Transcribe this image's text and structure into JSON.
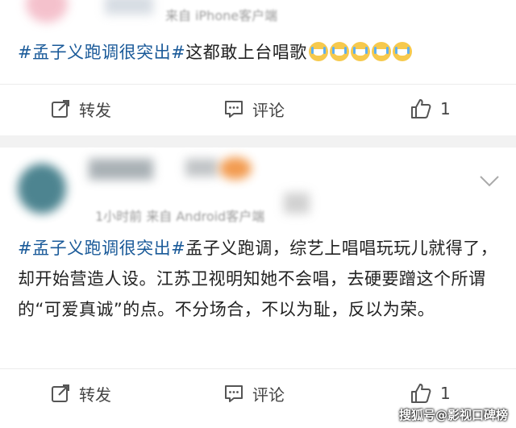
{
  "post1": {
    "source": "来自 iPhone客户端",
    "hashtag": "#孟子义跑调很突出#",
    "text": "这都敢上台唱歌",
    "emoji": [
      "crying-laugh",
      "crying-laugh",
      "crying-laugh",
      "crying-laugh",
      "crying-laugh"
    ],
    "repost_label": "转发",
    "comment_label": "评论",
    "like_count": "1"
  },
  "post2": {
    "time_source": "1小时前  来自 Android客户端",
    "hashtag": "#孟子义跑调很突出#",
    "text": "孟子义跑调，综艺上唱唱玩玩儿就得了，却开始营造人设。江苏卫视明知她不会唱，去硬要蹭这个所谓的“可爱真诚”的点。不分场合，不以为耻，反以为荣。",
    "repost_label": "转发",
    "comment_label": "评论",
    "like_count": "1"
  },
  "watermark": "搜狐号@影视口碑榜",
  "colors": {
    "hashtag": "#1a5a99",
    "background": "#f2f2f2"
  }
}
